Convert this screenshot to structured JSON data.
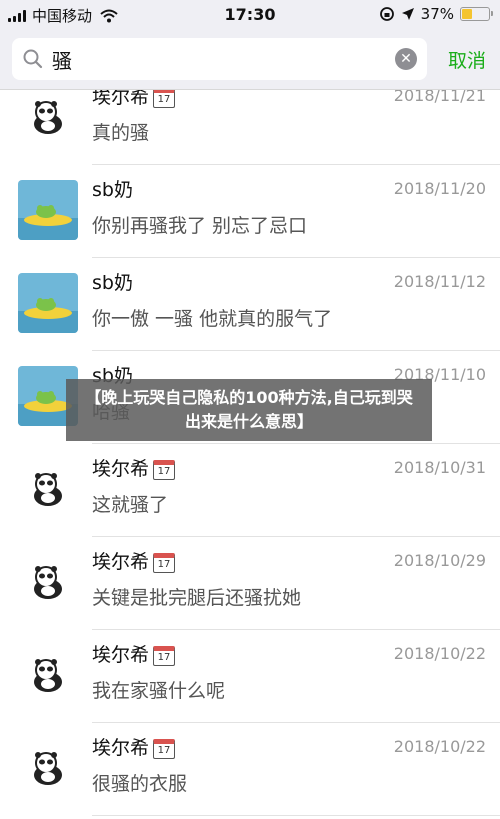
{
  "status_bar": {
    "carrier": "中国移动",
    "time": "17:30",
    "battery": "37%",
    "battery_level": 0.37
  },
  "search": {
    "query": "骚",
    "cancel_label": "取消"
  },
  "results": [
    {
      "name": "埃尔希",
      "calendar_badge": "17",
      "date": "2018/11/21",
      "snippet": "真的骚",
      "avatar": "panda"
    },
    {
      "name": "sb奶",
      "date": "2018/11/20",
      "snippet": "你别再骚我了 别忘了忌口",
      "avatar": "frog"
    },
    {
      "name": "sb奶",
      "date": "2018/11/12",
      "snippet": "你一傲 一骚 他就真的服气了",
      "avatar": "frog"
    },
    {
      "name": "sb奶",
      "date": "2018/11/10",
      "snippet": "哈骚",
      "avatar": "frog"
    },
    {
      "name": "埃尔希",
      "calendar_badge": "17",
      "date": "2018/10/31",
      "snippet": "这就骚了",
      "avatar": "panda"
    },
    {
      "name": "埃尔希",
      "calendar_badge": "17",
      "date": "2018/10/29",
      "snippet": "关键是批完腿后还骚扰她",
      "avatar": "panda"
    },
    {
      "name": "埃尔希",
      "calendar_badge": "17",
      "date": "2018/10/22",
      "snippet": "我在家骚什么呢",
      "avatar": "panda"
    },
    {
      "name": "埃尔希",
      "calendar_badge": "17",
      "date": "2018/10/22",
      "snippet": "很骚的衣服",
      "avatar": "panda"
    }
  ],
  "overlay": {
    "text": "【晚上玩哭自己隐私的100种方法,自己玩到哭出来是什么意思】"
  }
}
